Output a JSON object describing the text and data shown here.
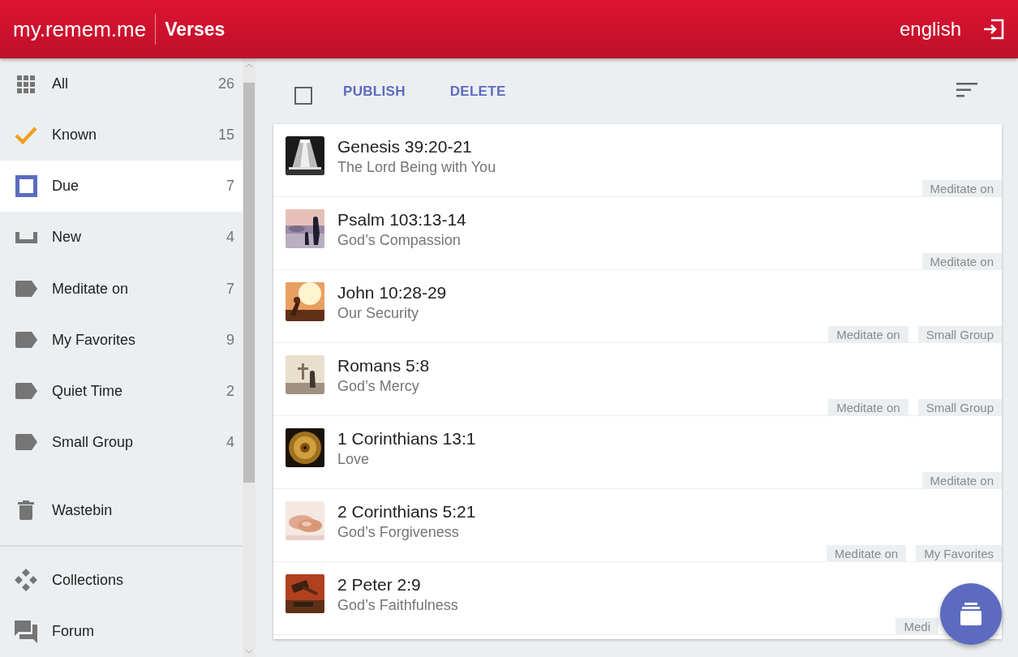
{
  "header": {
    "app_name": "my.remem.me",
    "section": "Verses",
    "language": "english"
  },
  "sidebar": {
    "items": [
      {
        "kind": "grid",
        "label": "All",
        "count": "26",
        "selected": false
      },
      {
        "kind": "check",
        "label": "Known",
        "count": "15",
        "selected": false
      },
      {
        "kind": "square",
        "label": "Due",
        "count": "7",
        "selected": true
      },
      {
        "kind": "tray",
        "label": "New",
        "count": "4",
        "selected": false
      },
      {
        "kind": "tag",
        "label": "Meditate on",
        "count": "7",
        "selected": false
      },
      {
        "kind": "tag",
        "label": "My Favorites",
        "count": "9",
        "selected": false
      },
      {
        "kind": "tag",
        "label": "Quiet Time",
        "count": "2",
        "selected": false
      },
      {
        "kind": "tag",
        "label": "Small Group",
        "count": "4",
        "selected": false
      },
      {
        "kind": "trash",
        "label": "Wastebin",
        "selected": false
      }
    ],
    "bottom_items": [
      {
        "kind": "diamonds",
        "label": "Collections",
        "selected": false
      },
      {
        "kind": "forum",
        "label": "Forum",
        "selected": false
      }
    ]
  },
  "toolbar": {
    "select_all_checked": false,
    "actions": [
      "PUBLISH",
      "DELETE"
    ]
  },
  "verses": [
    {
      "reference": "Genesis 39:20-21",
      "topic": "The Lord Being with You",
      "tags": [
        "Meditate on"
      ]
    },
    {
      "reference": "Psalm 103:13-14",
      "topic": "God’s Compassion",
      "tags": [
        "Meditate on"
      ]
    },
    {
      "reference": "John 10:28-29",
      "topic": "Our Security",
      "tags": [
        "Meditate on",
        "Small Group"
      ]
    },
    {
      "reference": "Romans 5:8",
      "topic": "God’s Mercy",
      "tags": [
        "Meditate on",
        "Small Group"
      ]
    },
    {
      "reference": "1 Corinthians 13:1",
      "topic": "Love",
      "tags": [
        "Meditate on"
      ]
    },
    {
      "reference": "2 Corinthians 5:21",
      "topic": "God’s Forgiveness",
      "tags": [
        "Meditate on",
        "My Favorites"
      ]
    },
    {
      "reference": "2 Peter 2:9",
      "topic": "God’s Faithfulness",
      "tags": [
        "Medi"
      ]
    }
  ]
}
